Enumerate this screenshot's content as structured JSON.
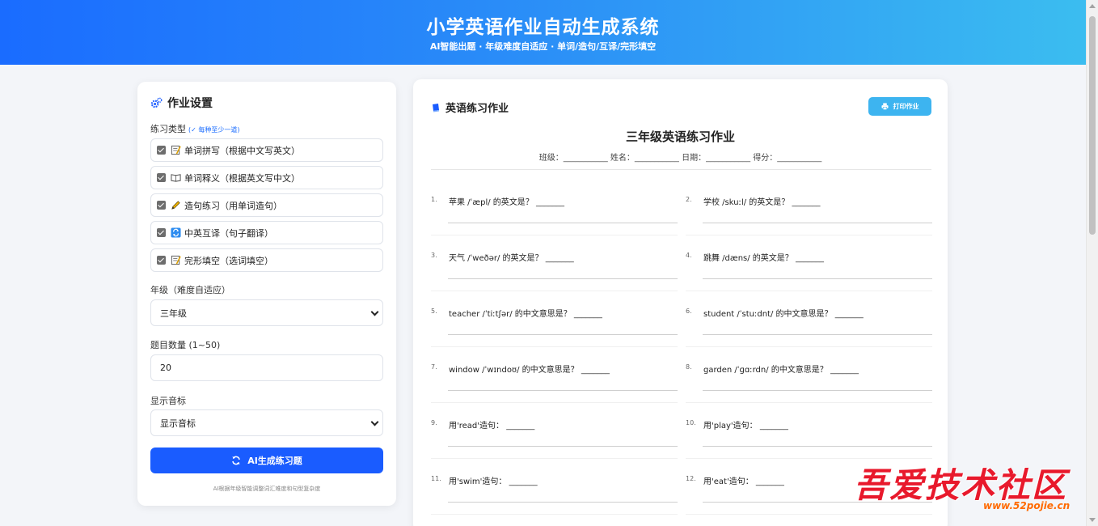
{
  "header": {
    "title": "小学英语作业自动生成系统",
    "subtitle": "AI智能出题 · 年级难度自适应 · 单词/造句/互译/完形填空"
  },
  "settings": {
    "title": "作业设置",
    "type_label": "练习类型",
    "type_hint": "(✓ 每种至少一道)",
    "types": [
      {
        "label": "单词拼写（根据中文写英文）",
        "icon": "memo-icon",
        "checked": true
      },
      {
        "label": "单词释义（根据英文写中文）",
        "icon": "open-book-icon",
        "checked": true
      },
      {
        "label": "造句练习（用单词造句）",
        "icon": "pencil-icon",
        "checked": true
      },
      {
        "label": "中英互译（句子翻译）",
        "icon": "swap-arrows-icon",
        "checked": true
      },
      {
        "label": "完形填空（选词填空）",
        "icon": "memo-icon",
        "checked": true
      }
    ],
    "grade_label": "年级（难度自适应）",
    "grade_value": "三年级",
    "count_label": "题目数量 (1~50)",
    "count_value": "20",
    "phonetic_label": "显示音标",
    "phonetic_value": "显示音标",
    "generate_label": "AI生成练习题",
    "footnote": "AI根据年级智能调整词汇难度和句型复杂度"
  },
  "worksheet": {
    "header_title": "英语练习作业",
    "print_label": "打印作业",
    "title": "三年级英语练习作业",
    "info": "班级：___________ 姓名：___________ 日期：___________ 得分：___________",
    "questions": [
      {
        "num": "1.",
        "text": "苹果 /ˈæpl/ 的英文是？ _______"
      },
      {
        "num": "2.",
        "text": "学校 /skuːl/ 的英文是？ _______"
      },
      {
        "num": "3.",
        "text": "天气 /ˈweðər/ 的英文是？ _______"
      },
      {
        "num": "4.",
        "text": "跳舞 /dæns/ 的英文是？ _______"
      },
      {
        "num": "5.",
        "text": "teacher /ˈtiːtʃər/ 的中文意思是？ _______"
      },
      {
        "num": "6.",
        "text": "student /ˈstuːdnt/ 的中文意思是？ _______"
      },
      {
        "num": "7.",
        "text": "window /ˈwɪndoʊ/ 的中文意思是？ _______"
      },
      {
        "num": "8.",
        "text": "garden /ˈɡɑːrdn/ 的中文意思是？ _______"
      },
      {
        "num": "9.",
        "text": "用'read'造句： _______"
      },
      {
        "num": "10.",
        "text": "用'play'造句： _______"
      },
      {
        "num": "11.",
        "text": "用'swim'造句： _______"
      },
      {
        "num": "12.",
        "text": "用'eat'造句： _______"
      }
    ]
  },
  "watermark": {
    "text": "吾爱技术社区",
    "url": "www.52pojie.cn"
  },
  "colors": {
    "primary": "#1a5cff",
    "print": "#3db4f0",
    "watermark": "#e8192c"
  }
}
